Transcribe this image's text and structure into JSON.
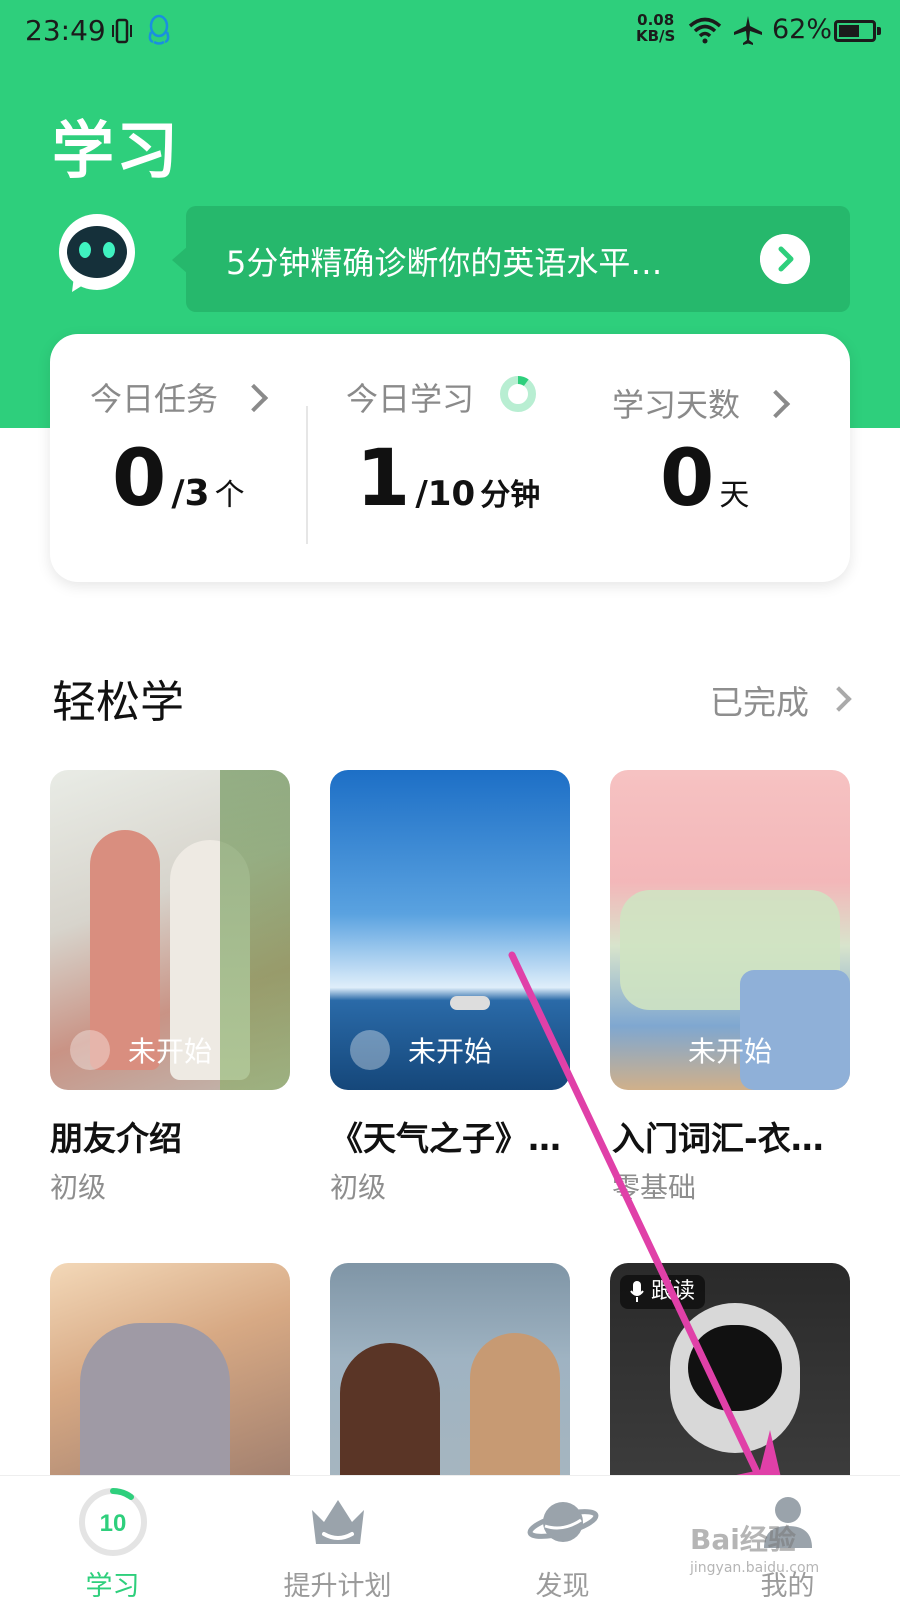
{
  "status_bar": {
    "time": "23:49",
    "net_speed_value": "0.08",
    "net_speed_unit": "KB/S",
    "battery": "62%",
    "battery_level": 0.62
  },
  "page": {
    "title": "学习"
  },
  "banner": {
    "text": "5分钟精确诊断你的英语水平…"
  },
  "stats": {
    "tasks": {
      "label": "今日任务",
      "value": "0",
      "total": "/3",
      "unit": "个"
    },
    "study": {
      "label": "今日学习",
      "value": "1",
      "total": "/10",
      "unit": "分钟",
      "progress": 0.1
    },
    "days": {
      "label": "学习天数",
      "value": "0",
      "unit": "天"
    }
  },
  "section": {
    "title": "轻松学",
    "link": "已完成"
  },
  "courses": [
    {
      "status": "未开始",
      "title": "朋友介绍",
      "level": "初级"
    },
    {
      "status": "未开始",
      "title": "《天气之子》…",
      "level": "初级"
    },
    {
      "status": "未开始",
      "title": "入门词汇-衣…",
      "level": "零基础"
    }
  ],
  "courses_row2_badge": "跟读",
  "nav": {
    "items": [
      {
        "label": "学习",
        "badge": "10",
        "active": true
      },
      {
        "label": "提升计划"
      },
      {
        "label": "发现"
      },
      {
        "label": "我的"
      }
    ]
  },
  "watermark": {
    "brand": "Bai经验",
    "url": "jingyan.baidu.com"
  },
  "colors": {
    "brand_green": "#2ecf7c",
    "annotation_arrow": "#e040a8"
  }
}
